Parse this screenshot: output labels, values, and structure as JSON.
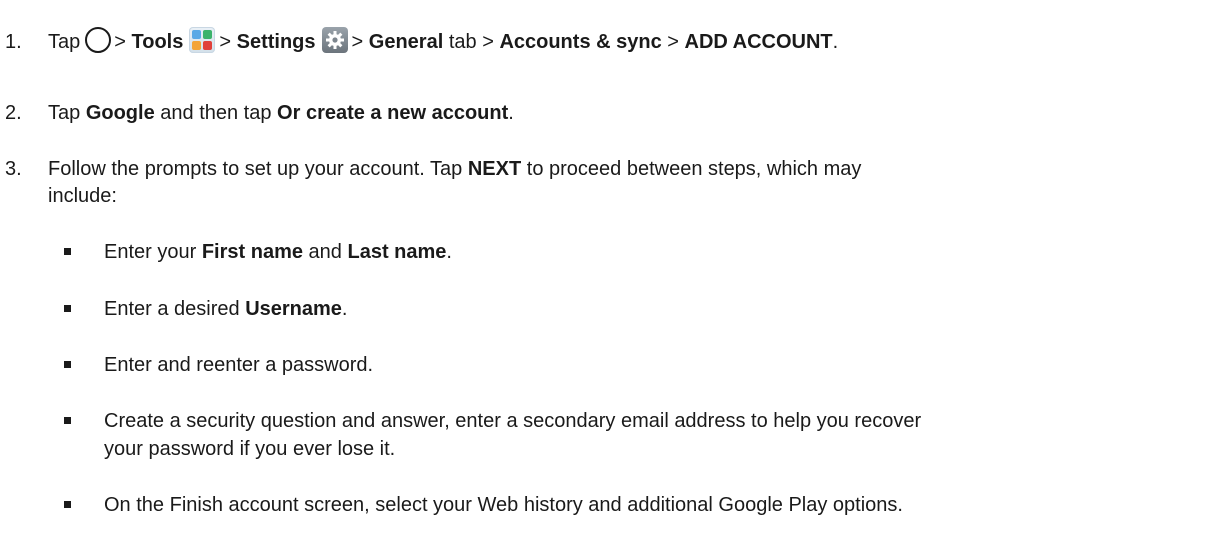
{
  "steps": [
    {
      "number": "1.",
      "tap": "Tap",
      "sep1": ">",
      "tools": "Tools",
      "sep2": ">",
      "settings": "Settings",
      "sep3": ">",
      "general": "General",
      "tab": "tab",
      "sep4": ">",
      "accounts_sync": "Accounts & sync",
      "sep5": ">",
      "add_account": "ADD ACCOUNT",
      "end": "."
    },
    {
      "number": "2.",
      "tap": "Tap",
      "google": "Google",
      "then": "and then tap",
      "create": "Or create a new account",
      "end": "."
    },
    {
      "number": "3.",
      "line1_pre": "Follow the prompts to set up your account. Tap",
      "next": "NEXT",
      "line1_post": "to proceed between steps, which may",
      "line2": "include:"
    }
  ],
  "substeps": [
    {
      "pre": "Enter your",
      "b1": "First name",
      "mid": "and",
      "b2": "Last name",
      "end": "."
    },
    {
      "pre": "Enter a desired",
      "b1": "Username",
      "end": "."
    },
    {
      "text": "Enter and reenter a password."
    },
    {
      "line1": "Create a security question and answer, enter a secondary email address to help you recover",
      "line2": "your password if you ever lose it."
    },
    {
      "text": "On the Finish account screen, select your Web history and additional Google Play options."
    }
  ],
  "icons": {
    "home": "home-circle-icon",
    "tools": "tools-folder-icon",
    "settings": "settings-gear-icon"
  }
}
